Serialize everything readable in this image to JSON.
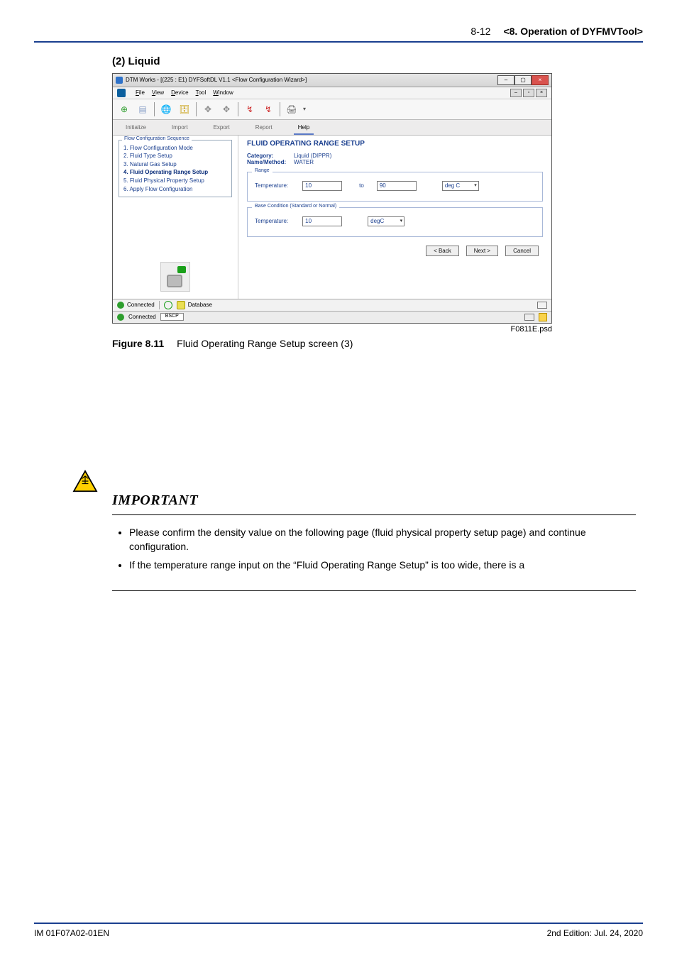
{
  "header": {
    "page_number": "8-12",
    "chapter": "<8.  Operation of DYFMVTool>"
  },
  "section_heading": "(2)   Liquid",
  "screenshot": {
    "window_title": "DTM Works - [(225 : E1) DYFSoftDL V1.1 <Flow Configuration Wizard>]",
    "menubar": [
      "File",
      "View",
      "Device",
      "Tool",
      "Window"
    ],
    "tabs": {
      "items": [
        "Initialize",
        "Import",
        "Export",
        "Report",
        "Help"
      ],
      "active_index": 4
    },
    "sidebar": {
      "legend": "Flow Configuration Sequence",
      "steps": [
        "1. Flow Configuration Mode",
        "2. Fluid Type Setup",
        "3. Natural Gas Setup",
        "4. Fluid Operating Range Setup",
        "5. Fluid Physical Property Setup",
        "6. Apply Flow Configuration"
      ],
      "active_step_index": 3
    },
    "main": {
      "title": "FLUID OPERATING RANGE SETUP",
      "category_label": "Category:",
      "category_value": "Liquid (DIPPR)",
      "name_label": "Name/Method:",
      "name_value": "WATER",
      "range": {
        "legend": "Range",
        "temp_label": "Temperature:",
        "temp_from": "10",
        "to_word": "to",
        "temp_to": "90",
        "unit": "deg C"
      },
      "base": {
        "legend": "Base Condition (Standard or Normal)",
        "temp_label": "Temperature:",
        "temp_value": "10",
        "unit": "degC"
      },
      "buttons": {
        "back": "< Back",
        "next": "Next >",
        "cancel": "Cancel"
      }
    },
    "status": {
      "connected": "Connected",
      "database": "Database",
      "connected2": "Connected",
      "bscp": "BSCP"
    },
    "figfile": "F0811E.psd"
  },
  "caption": {
    "label": "Figure 8.11",
    "text": "Fluid Operating Range Setup screen (3)"
  },
  "important": {
    "title": "IMPORTANT",
    "bullets": [
      "Please confirm the density value on the following page (fluid physical property setup page) and continue configuration.",
      "If the temperature range input on the “Fluid Operating Range Setup” is too wide, there is a"
    ]
  },
  "footer": {
    "docno": "IM 01F07A02-01EN",
    "date": "2nd Edition: Jul. 24, 2020"
  }
}
